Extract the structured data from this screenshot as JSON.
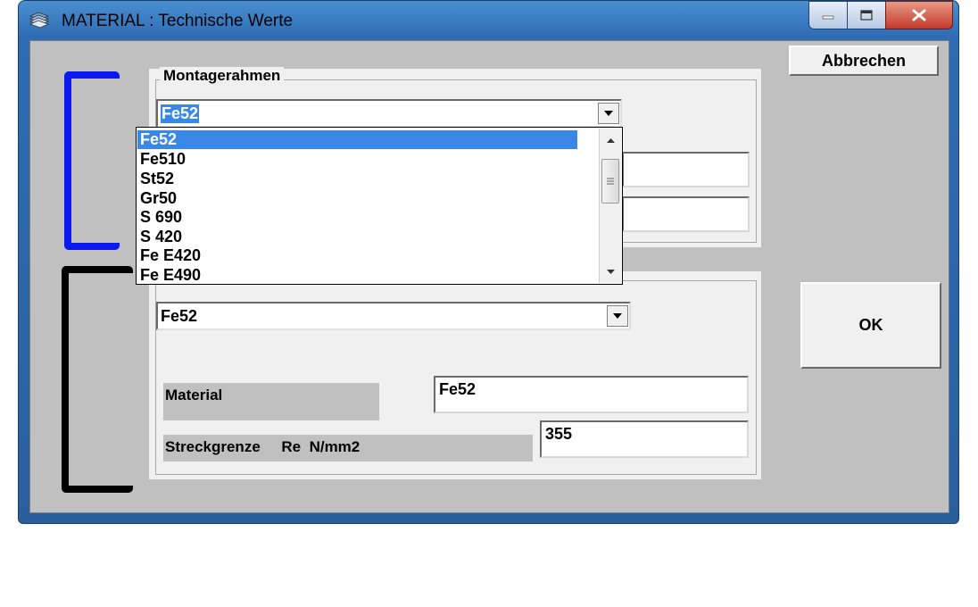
{
  "window": {
    "title": "MATERIAL :  Technische Werte"
  },
  "buttons": {
    "cancel": "Abbrechen",
    "ok": "OK"
  },
  "montagerahmen": {
    "legend": "Montagerahmen",
    "combo_value": "Fe52",
    "dropdown_options": [
      "Fe52",
      "Fe510",
      "St52",
      "Gr50",
      "S 690",
      "S 420",
      "Fe E420",
      "Fe E490"
    ],
    "highlighted_option": "Fe52"
  },
  "lower_group": {
    "combo_value": "Fe52",
    "material_label": "Material",
    "material_value": "Fe52",
    "yield_label": "Streckgrenze     Re  N/mm2",
    "yield_value": "355"
  },
  "colors": {
    "blue_bracket": "#0a1aee",
    "black_bracket": "#000000",
    "highlight": "#3a88e6"
  }
}
